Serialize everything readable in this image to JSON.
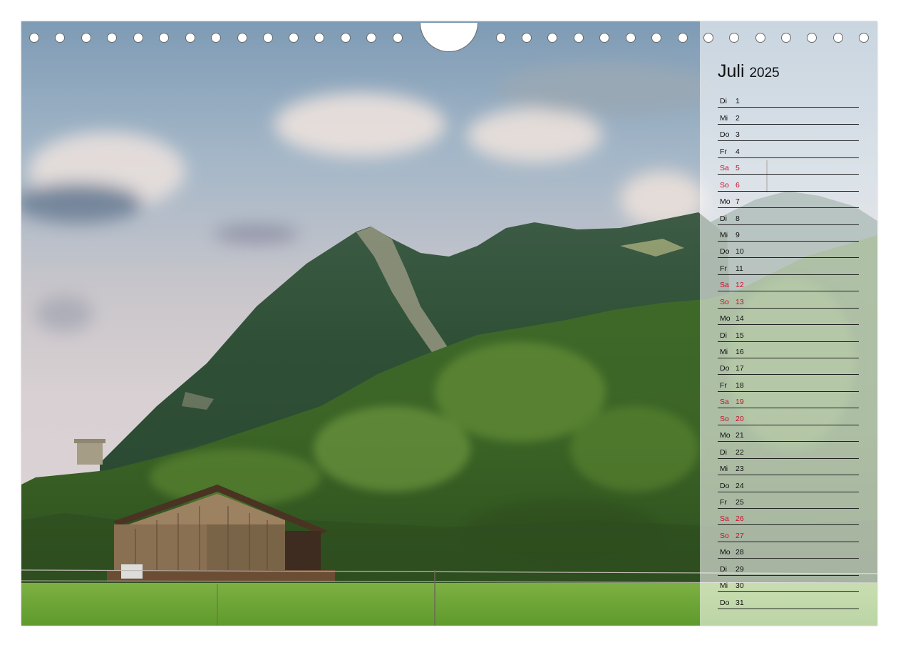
{
  "calendar": {
    "month": "Juli",
    "year": "2025",
    "days": [
      {
        "wd": "Di",
        "d": "1",
        "weekend": false
      },
      {
        "wd": "Mi",
        "d": "2",
        "weekend": false
      },
      {
        "wd": "Do",
        "d": "3",
        "weekend": false
      },
      {
        "wd": "Fr",
        "d": "4",
        "weekend": false
      },
      {
        "wd": "Sa",
        "d": "5",
        "weekend": true
      },
      {
        "wd": "So",
        "d": "6",
        "weekend": true
      },
      {
        "wd": "Mo",
        "d": "7",
        "weekend": false
      },
      {
        "wd": "Di",
        "d": "8",
        "weekend": false
      },
      {
        "wd": "Mi",
        "d": "9",
        "weekend": false
      },
      {
        "wd": "Do",
        "d": "10",
        "weekend": false
      },
      {
        "wd": "Fr",
        "d": "11",
        "weekend": false
      },
      {
        "wd": "Sa",
        "d": "12",
        "weekend": true
      },
      {
        "wd": "So",
        "d": "13",
        "weekend": true
      },
      {
        "wd": "Mo",
        "d": "14",
        "weekend": false
      },
      {
        "wd": "Di",
        "d": "15",
        "weekend": false
      },
      {
        "wd": "Mi",
        "d": "16",
        "weekend": false
      },
      {
        "wd": "Do",
        "d": "17",
        "weekend": false
      },
      {
        "wd": "Fr",
        "d": "18",
        "weekend": false
      },
      {
        "wd": "Sa",
        "d": "19",
        "weekend": true
      },
      {
        "wd": "So",
        "d": "20",
        "weekend": true
      },
      {
        "wd": "Mo",
        "d": "21",
        "weekend": false
      },
      {
        "wd": "Di",
        "d": "22",
        "weekend": false
      },
      {
        "wd": "Mi",
        "d": "23",
        "weekend": false
      },
      {
        "wd": "Do",
        "d": "24",
        "weekend": false
      },
      {
        "wd": "Fr",
        "d": "25",
        "weekend": false
      },
      {
        "wd": "Sa",
        "d": "26",
        "weekend": true
      },
      {
        "wd": "So",
        "d": "27",
        "weekend": true
      },
      {
        "wd": "Mo",
        "d": "28",
        "weekend": false
      },
      {
        "wd": "Di",
        "d": "29",
        "weekend": false
      },
      {
        "wd": "Mi",
        "d": "30",
        "weekend": false
      },
      {
        "wd": "Do",
        "d": "31",
        "weekend": false
      }
    ]
  },
  "colors": {
    "weekend": "#c8102e",
    "text": "#111111",
    "rule": "#222222"
  },
  "photo": {
    "subject": "mountain-landscape"
  }
}
